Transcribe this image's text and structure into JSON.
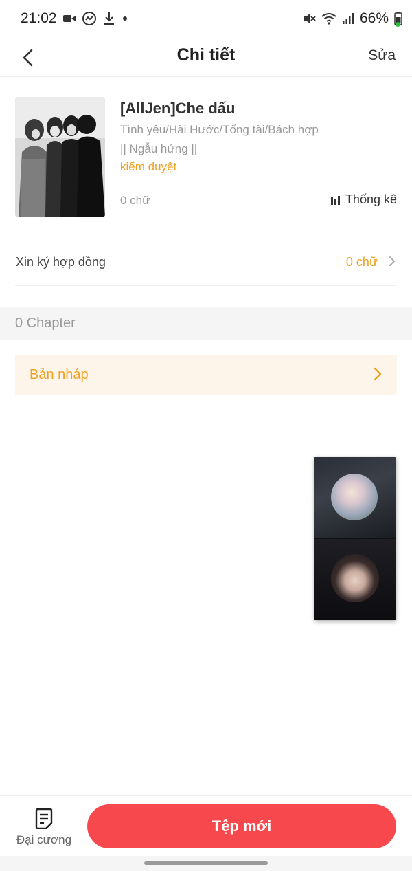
{
  "status_bar": {
    "time": "21:02",
    "battery": "66%",
    "left_icons": [
      "video-icon",
      "messenger-icon",
      "download-icon",
      "dot-icon"
    ],
    "right_icons": [
      "mute-icon",
      "wifi-icon",
      "signal-icon",
      "battery-icon"
    ]
  },
  "nav": {
    "title": "Chi tiết",
    "edit_label": "Sửa"
  },
  "book": {
    "title": "[AllJen]Che dấu",
    "genres": "Tình yêu/Hài Hước/Tổng tài/Bách hợp",
    "description": "|| Ngẫu hứng ||",
    "status": "kiểm duyệt",
    "word_count": "0 chữ",
    "stats_label": "Thống kê"
  },
  "contract": {
    "label": "Xin ký hợp đồng",
    "value": "0 chữ"
  },
  "chapters": {
    "count_label": "0 Chapter"
  },
  "draft": {
    "label": "Bản nháp"
  },
  "bottom_bar": {
    "outline_label": "Đại cương",
    "new_file_label": "Tệp mới"
  },
  "colors": {
    "accent_orange": "#f0a020",
    "primary_red": "#f7494d",
    "draft_bg": "#fdf5e9"
  }
}
